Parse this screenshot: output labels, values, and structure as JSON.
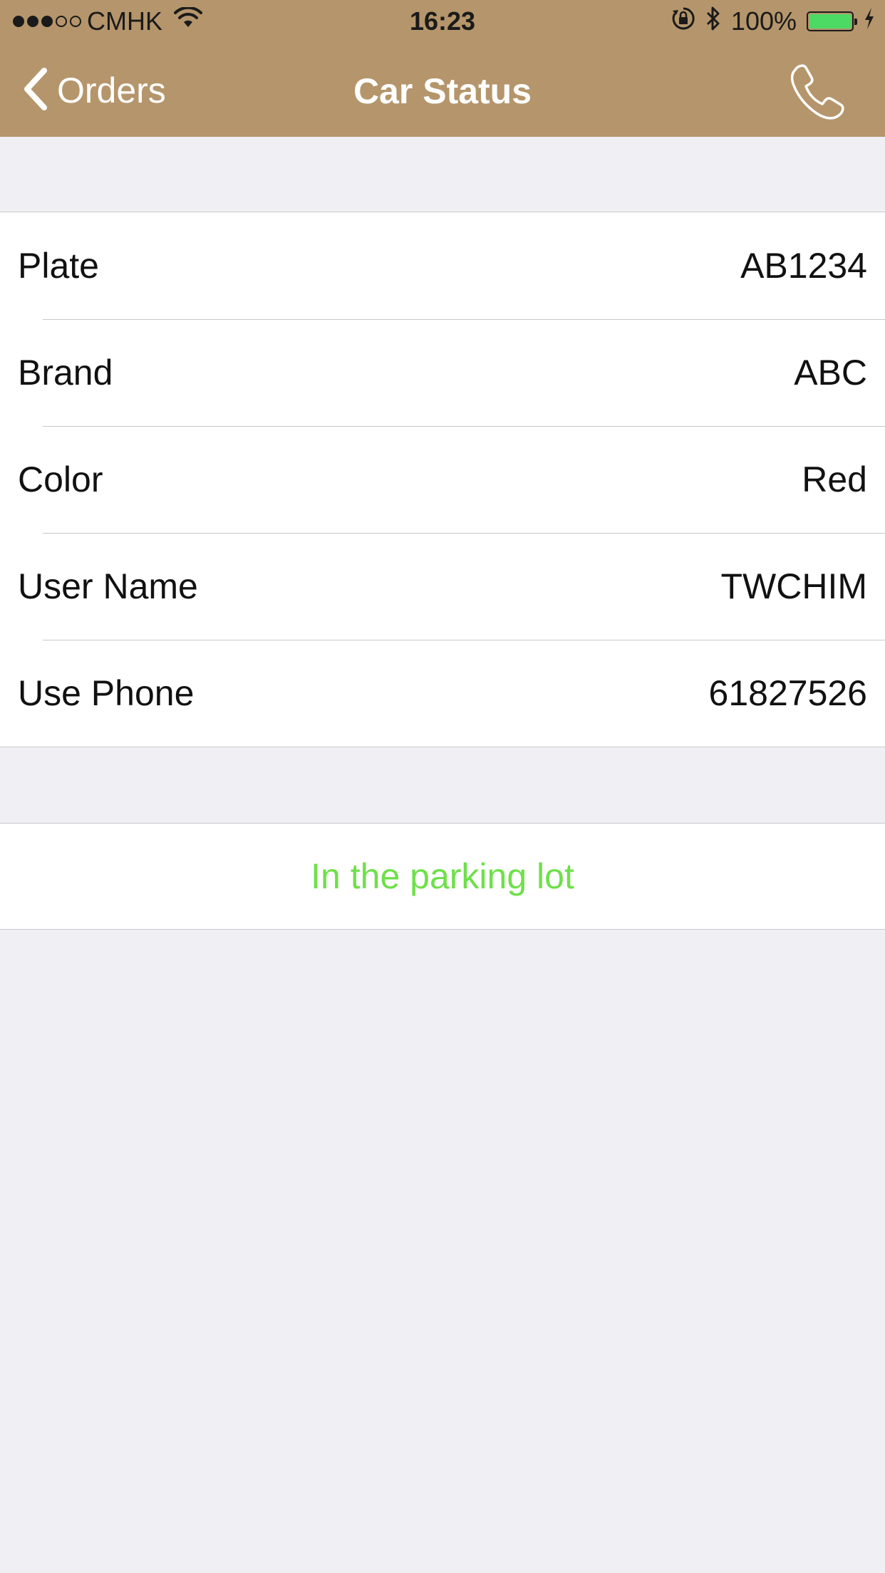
{
  "status_bar": {
    "carrier": "CMHK",
    "time": "16:23",
    "battery_percent": "100%",
    "signal_strength": 3,
    "signal_max": 5,
    "icons": [
      "wifi-icon",
      "rotation-lock-icon",
      "bluetooth-icon",
      "charging-icon"
    ],
    "battery_color": "#4cd964"
  },
  "nav": {
    "back_label": "Orders",
    "title": "Car Status",
    "action_icon": "phone-icon",
    "background_color": "#b5956b"
  },
  "details": [
    {
      "label": "Plate",
      "value": "AB1234"
    },
    {
      "label": "Brand",
      "value": "ABC"
    },
    {
      "label": "Color",
      "value": "Red"
    },
    {
      "label": "User Name",
      "value": "TWCHIM"
    },
    {
      "label": "Use Phone",
      "value": "61827526"
    }
  ],
  "status": {
    "text": "In the parking lot",
    "color": "#6fe04a"
  }
}
